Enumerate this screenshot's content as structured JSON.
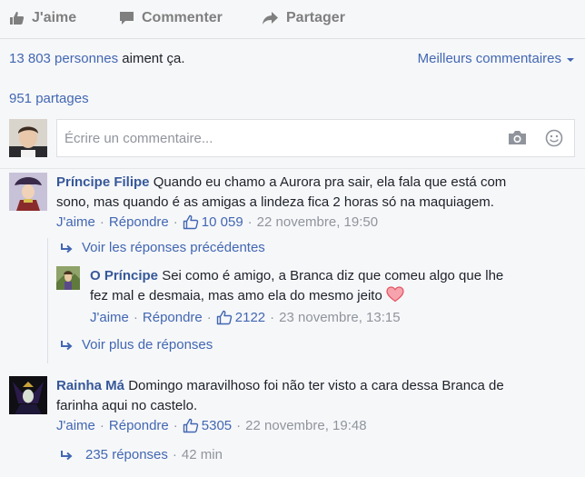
{
  "actions": {
    "like_label": "J'aime",
    "comment_label": "Commenter",
    "share_label": "Partager"
  },
  "summary": {
    "likes_count": "13 803 personnes",
    "likes_suffix": "aiment ça.",
    "sort_label": "Meilleurs commentaires",
    "shares": "951 partages"
  },
  "composer": {
    "placeholder": "Écrire un commentaire..."
  },
  "comments": [
    {
      "author": "Príncipe Filipe",
      "text_line1": "Quando eu chamo a Aurora pra sair, ela fala que está com",
      "text_line2": "sono, mas quando é as amigas a lindeza fica 2 horas só na maquiagem.",
      "like_label": "J'aime",
      "reply_label": "Répondre",
      "likes": "10 059",
      "date": "22 novembre, 19:50"
    },
    {
      "author": "Rainha Má",
      "text_line1": "Domingo maravilhoso foi não ter visto a cara dessa Branca de",
      "text_line2": "farinha aqui no castelo.",
      "like_label": "J'aime",
      "reply_label": "Répondre",
      "likes": "5305",
      "date": "22 novembre, 19:48"
    }
  ],
  "previous_replies_label": "Voir les réponses précédentes",
  "reply": {
    "author": "O Príncipe",
    "text_line1": "Sei como é amigo, a Branca diz que comeu algo que lhe",
    "text_line2": "fez mal e desmaia, mas amo ela do mesmo jeito",
    "like_label": "J'aime",
    "reply_label": "Répondre",
    "likes": "2122",
    "date": "23 novembre, 13:15"
  },
  "more_replies_label": "Voir plus de réponses",
  "replies_summary": {
    "count": "235 réponses",
    "time": "42 min"
  },
  "colors": {
    "link": "#4267b2",
    "name": "#365899",
    "meta": "#90949c",
    "background": "#f6f7f9"
  }
}
